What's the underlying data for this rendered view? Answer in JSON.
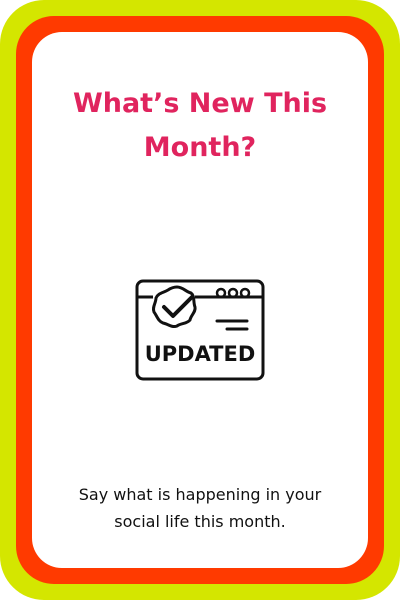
{
  "card": {
    "title": "What’s New This\nMonth?",
    "icon": {
      "name": "updated-browser-icon",
      "badge_text": "UPDATED"
    },
    "caption": "Say what is happening in your\nsocial life this month."
  },
  "colors": {
    "outer_frame": "#d4e600",
    "middle_frame": "#ff3a00",
    "card_background": "#ffffff",
    "title": "#e0245e",
    "caption": "#111111",
    "icon_stroke": "#111111"
  }
}
